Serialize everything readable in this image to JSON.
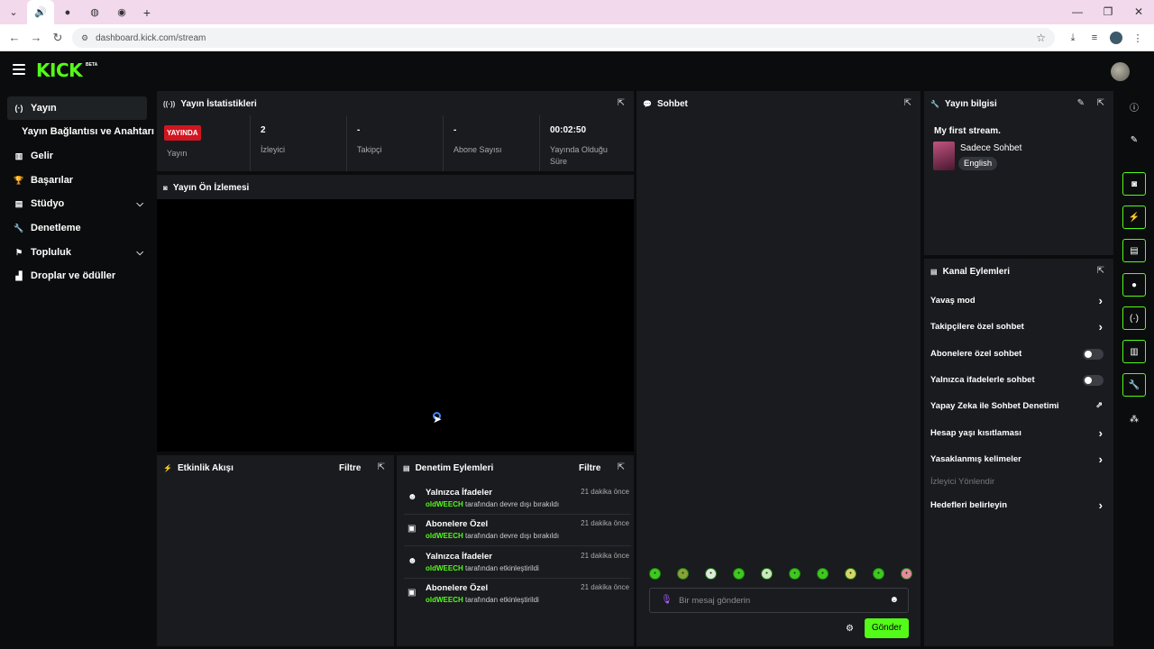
{
  "browser": {
    "tab_icons": [
      "speaker-icon",
      "kick-favicon",
      "kick-favicon",
      "kick-favicon"
    ],
    "new_tab": "+",
    "url": "dashboard.kick.com/stream"
  },
  "header": {
    "logo": "KICK",
    "beta": "BETA"
  },
  "sidebar": {
    "items": [
      {
        "label": "Yayın",
        "icon": "broadcast-icon"
      },
      {
        "label": "Yayın Bağlantısı ve Anahtarı"
      },
      {
        "label": "Gelir",
        "icon": "revenue-icon"
      },
      {
        "label": "Başarılar",
        "icon": "trophy-icon"
      },
      {
        "label": "Stüdyo",
        "icon": "studio-icon"
      },
      {
        "label": "Denetleme",
        "icon": "wrench-icon"
      },
      {
        "label": "Topluluk",
        "icon": "community-icon"
      },
      {
        "label": "Droplar ve ödüller",
        "icon": "drops-icon"
      }
    ]
  },
  "stats": {
    "title": "Yayın İstatistikleri",
    "live_badge": "YAYINDA",
    "live_label": "Yayın",
    "viewers_value": "2",
    "viewers_label": "İzleyici",
    "followers_value": "-",
    "followers_label": "Takipçi",
    "subs_value": "-",
    "subs_label": "Abone Sayısı",
    "uptime_value": "00:02:50",
    "uptime_label": "Yayında Olduğu Süre"
  },
  "preview": {
    "title": "Yayın Ön İzlemesi"
  },
  "activity": {
    "title": "Etkinlik Akışı",
    "filter": "Filtre"
  },
  "moderation": {
    "title": "Denetim Eylemleri",
    "filter": "Filtre",
    "items": [
      {
        "title": "Yalnızca İfadeler",
        "time": "21 dakika önce",
        "user": "oldWEECH",
        "action": "tarafından devre dışı bırakıldı",
        "icon": "emoji-icon"
      },
      {
        "title": "Abonelere Özel",
        "time": "21 dakika önce",
        "user": "oldWEECH",
        "action": "tarafından devre dışı bırakıldı",
        "icon": "gift-icon"
      },
      {
        "title": "Yalnızca İfadeler",
        "time": "21 dakika önce",
        "user": "oldWEECH",
        "action": "tarafından etkinleştirildi",
        "icon": "emoji-icon"
      },
      {
        "title": "Abonelere Özel",
        "time": "21 dakika önce",
        "user": "oldWEECH",
        "action": "tarafından etkinleştirildi",
        "icon": "gift-icon"
      }
    ]
  },
  "chat": {
    "title": "Sohbet",
    "placeholder": "Bir mesaj gönderin",
    "send": "Gönder"
  },
  "stream_info": {
    "title": "Yayın bilgisi",
    "stream_title": "My first stream.",
    "category": "Sadece Sohbet",
    "language": "English"
  },
  "channel_actions": {
    "title": "Kanal Eylemleri",
    "rows": [
      {
        "label": "Yavaş mod",
        "control": "chevron"
      },
      {
        "label": "Takipçilere özel sohbet",
        "control": "chevron"
      },
      {
        "label": "Abonelere özel sohbet",
        "control": "toggle",
        "on": false
      },
      {
        "label": "Yalnızca ifadelerle sohbet",
        "control": "toggle",
        "on": false
      },
      {
        "label": "Yapay Zeka ile Sohbet Denetimi",
        "control": "external"
      },
      {
        "label": "Hesap yaşı kısıtlaması",
        "control": "chevron"
      },
      {
        "label": "Yasaklanmış kelimeler",
        "control": "chevron"
      },
      {
        "label": "İzleyici Yönlendir",
        "control": "none",
        "disabled": true
      },
      {
        "label": "Hedefleri belirleyin",
        "control": "chevron"
      }
    ]
  },
  "colors": {
    "accent": "#53fc18",
    "live": "#d01620",
    "panel": "#191b1f",
    "background": "#0b0c0d"
  }
}
